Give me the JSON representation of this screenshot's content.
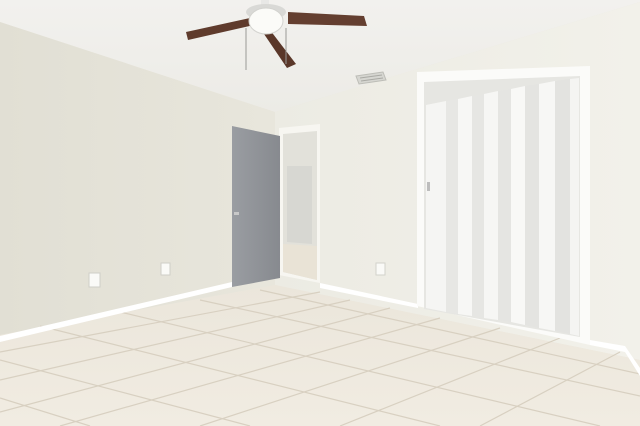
{
  "scene": {
    "type": "empty bedroom interior",
    "elements": [
      "ceiling-fan",
      "ceiling-light",
      "air-vent",
      "open-door",
      "doorway-hall",
      "folding-closet-door",
      "floor-tiles",
      "baseboards",
      "electrical-outlets"
    ]
  },
  "colors": {
    "ceiling": "#f3f2ee",
    "left_wall": "#e4e2d8",
    "right_wall": "#efeee6",
    "floor_tile": "#ece6da",
    "grout": "#d9d1c2",
    "door": "#8e9196",
    "closet_door": "#f4f4f2",
    "fan_blade": "#5e3a2c",
    "trim": "#ffffff"
  }
}
